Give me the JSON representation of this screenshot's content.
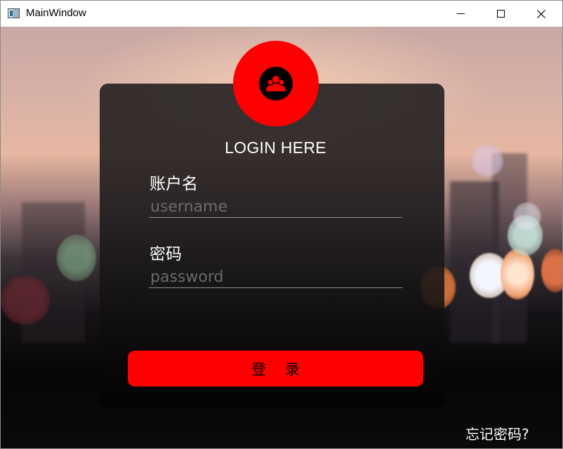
{
  "window": {
    "title": "MainWindow",
    "icons": [
      "app-icon",
      "minimize-icon",
      "maximize-icon",
      "close-icon"
    ]
  },
  "login": {
    "avatar_icon": "users-group-icon",
    "heading": "LOGIN HERE",
    "username_label": "账户名",
    "username_placeholder": "username",
    "username_value": "",
    "password_label": "密码",
    "password_placeholder": "password",
    "password_value": "",
    "submit_label": "登 录",
    "forgot_label": "忘记密码?"
  },
  "colors": {
    "accent": "#ff0000",
    "card_bg": "#1e1c1c",
    "text": "#ffffff",
    "placeholder": "#6a6a6a"
  }
}
